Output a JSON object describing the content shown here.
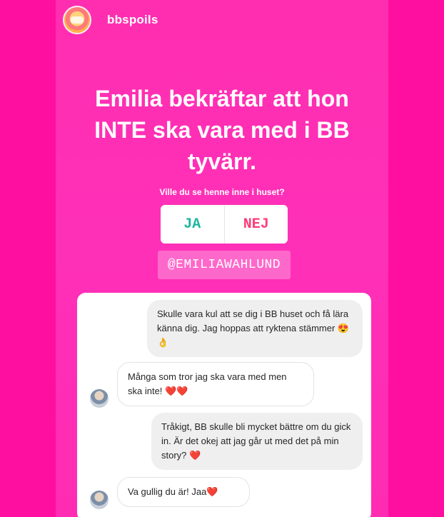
{
  "story": {
    "username": "bbspoils",
    "headline_lines": [
      "Emilia bekräftar att hon",
      "INTE ska vara med i BB",
      "tyvärr."
    ],
    "poll": {
      "question": "Ville du se henne inne i huset?",
      "option_yes": "JA",
      "option_no": "NEJ"
    },
    "mention": "@EMILIAWAHLUND"
  },
  "chat": {
    "messages": [
      {
        "side": "sent",
        "text": "Skulle vara kul att se dig i BB huset och få lära känna dig. Jag hoppas att ryktena stämmer 😍👌"
      },
      {
        "side": "received",
        "text": "Många som tror jag ska vara med men ska inte! ❤️❤️"
      },
      {
        "side": "sent",
        "text": "Tråkigt, BB skulle bli mycket bättre om du gick in. Är det okej att jag går ut med det på min story? ❤️"
      },
      {
        "side": "received",
        "text": "Va gullig du är! Jaa❤️"
      }
    ]
  },
  "colors": {
    "background": "#ff1aa8",
    "poll_yes": "#1ab6a0",
    "poll_no": "#ff3d7a"
  },
  "icons": {
    "avatar": "profile-avatar",
    "chat_avatar": "user-avatar"
  }
}
